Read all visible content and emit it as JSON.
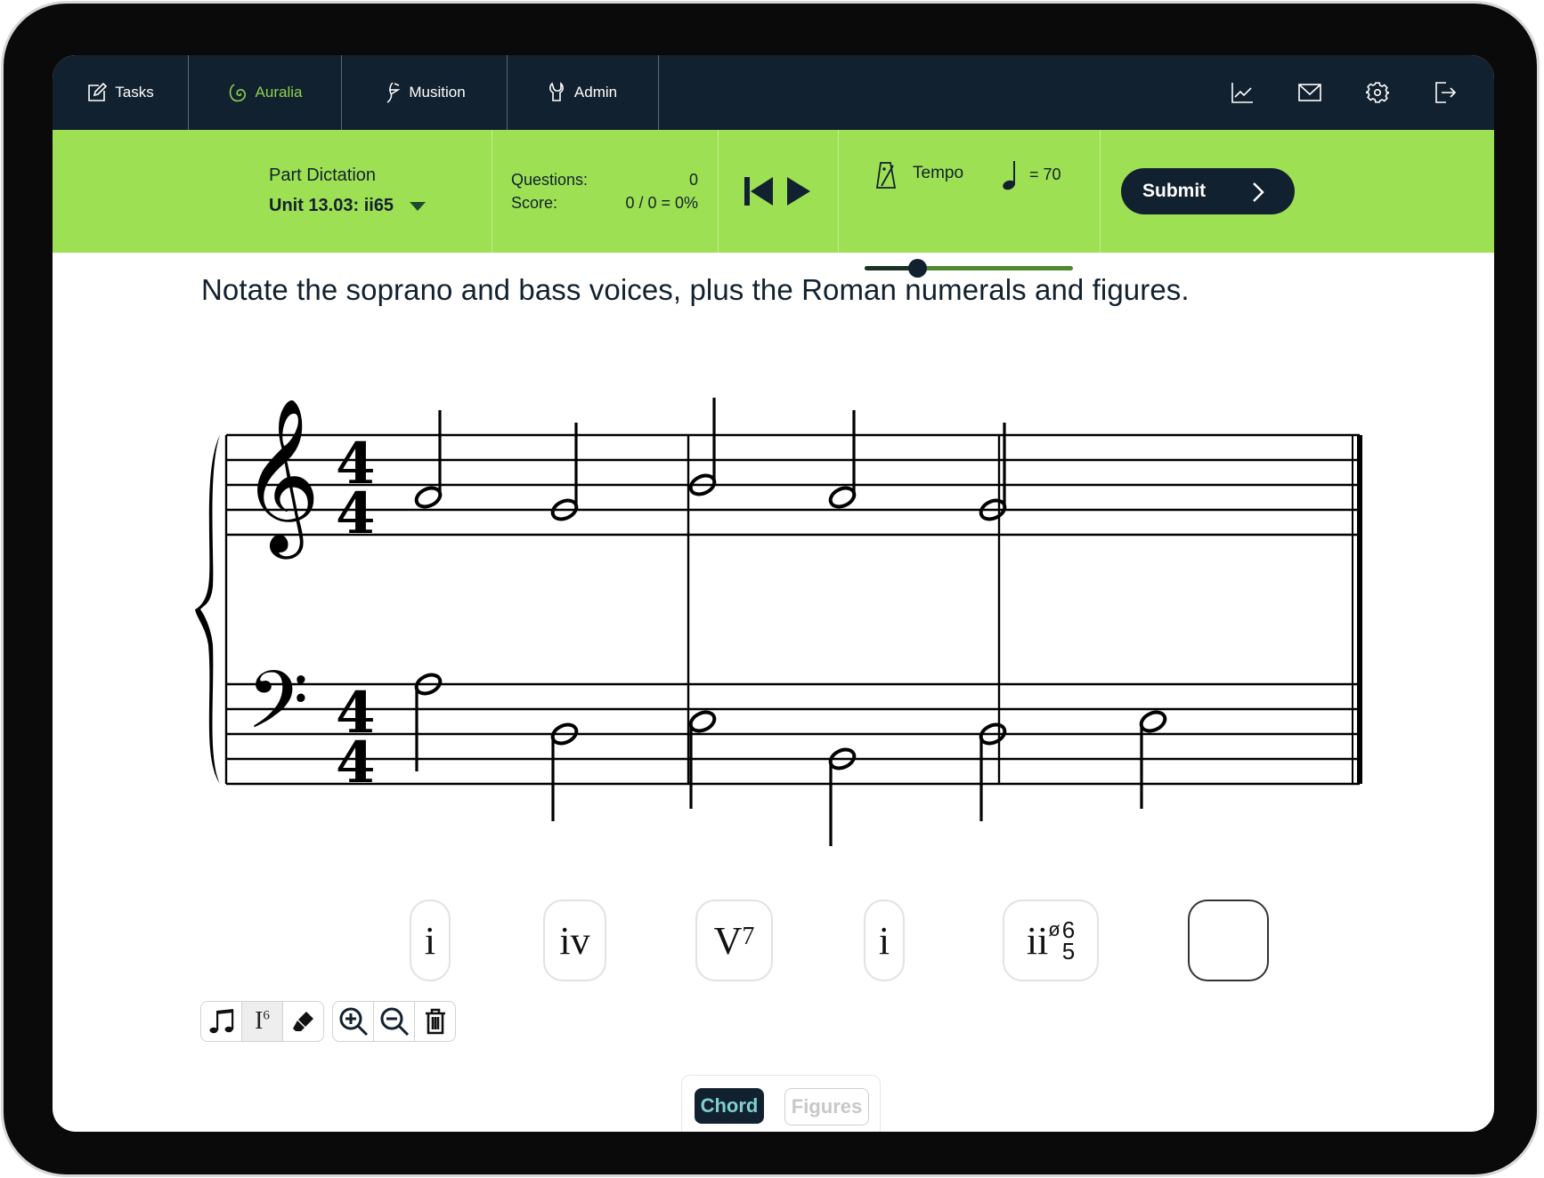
{
  "nav": {
    "items": [
      {
        "label": "Tasks",
        "icon": "edit-icon",
        "active": false
      },
      {
        "label": "Auralia",
        "icon": "auralia-logo-icon",
        "active": true
      },
      {
        "label": "Musition",
        "icon": "musition-logo-icon",
        "active": false
      },
      {
        "label": "Admin",
        "icon": "wrench-icon",
        "active": false
      }
    ],
    "right_icons": [
      "chart-icon",
      "mail-icon",
      "gear-icon",
      "logout-icon"
    ],
    "active_color": "#8fd14f"
  },
  "task": {
    "title": "Part Dictation",
    "unit": "Unit 13.03: ii65",
    "questions_label": "Questions:",
    "questions_value": "0",
    "score_label": "Score:",
    "score_value": "0 / 0 = 0%"
  },
  "tempo": {
    "label": "Tempo",
    "value_text": "= 70",
    "bpm": 70,
    "slider_fraction": 0.25
  },
  "submit_label": "Submit",
  "instruction": "Notate the soprano and bass voices, plus the Roman numerals and figures.",
  "score": {
    "time_signature": "4/4",
    "clefs": [
      "treble",
      "bass"
    ],
    "soprano": [
      {
        "measure": 1,
        "pitch": "A4",
        "duration": "half"
      },
      {
        "measure": 1,
        "pitch": "G4",
        "duration": "half"
      },
      {
        "measure": 2,
        "pitch": "B4",
        "duration": "half"
      },
      {
        "measure": 2,
        "pitch": "A4",
        "duration": "half"
      },
      {
        "measure": 3,
        "pitch": "G4",
        "duration": "half"
      }
    ],
    "bass": [
      {
        "measure": 1,
        "pitch": "A3",
        "duration": "half"
      },
      {
        "measure": 1,
        "pitch": "D3",
        "duration": "half"
      },
      {
        "measure": 2,
        "pitch": "E3",
        "duration": "half"
      },
      {
        "measure": 2,
        "pitch": "B2",
        "duration": "half"
      },
      {
        "measure": 3,
        "pitch": "D3",
        "duration": "half"
      },
      {
        "measure": 3,
        "pitch": "E3",
        "duration": "half"
      }
    ]
  },
  "chords": [
    {
      "numeral": "i",
      "sup": "",
      "fig_top": "",
      "fig_bottom": ""
    },
    {
      "numeral": "iv",
      "sup": "",
      "fig_top": "",
      "fig_bottom": ""
    },
    {
      "numeral": "V",
      "sup": "7",
      "fig_top": "",
      "fig_bottom": ""
    },
    {
      "numeral": "i",
      "sup": "",
      "fig_top": "",
      "fig_bottom": ""
    },
    {
      "numeral": "ii",
      "sup": "ø",
      "fig_top": "6",
      "fig_bottom": "5"
    },
    {
      "numeral": "",
      "sup": "",
      "fig_top": "",
      "fig_bottom": "",
      "selected": true
    }
  ],
  "tools": {
    "left": [
      "notes-icon",
      "roman-numeral-icon",
      "eraser-icon"
    ],
    "roman_tool_label": "I",
    "roman_tool_sup": "6",
    "right": [
      "zoom-in-icon",
      "zoom-out-icon",
      "trash-icon"
    ]
  },
  "tabs": [
    {
      "label": "Chord",
      "active": true
    },
    {
      "label": "Figures",
      "active": false
    }
  ]
}
